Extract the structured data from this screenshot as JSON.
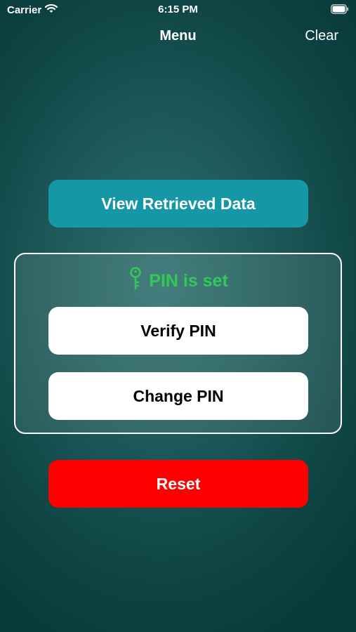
{
  "status_bar": {
    "carrier": "Carrier",
    "time": "6:15 PM",
    "icons": [
      "wifi-icon",
      "battery-icon"
    ]
  },
  "nav": {
    "title": "Menu",
    "clear_label": "Clear"
  },
  "buttons": {
    "view_data": "View Retrieved Data",
    "verify_pin": "Verify PIN",
    "change_pin": "Change PIN",
    "reset": "Reset"
  },
  "pin_panel": {
    "status_text": "PIN is set",
    "status_icon": "key-icon"
  },
  "colors": {
    "accent_teal": "#1597a6",
    "status_green": "#34c759",
    "reset_red": "#ff0000"
  }
}
